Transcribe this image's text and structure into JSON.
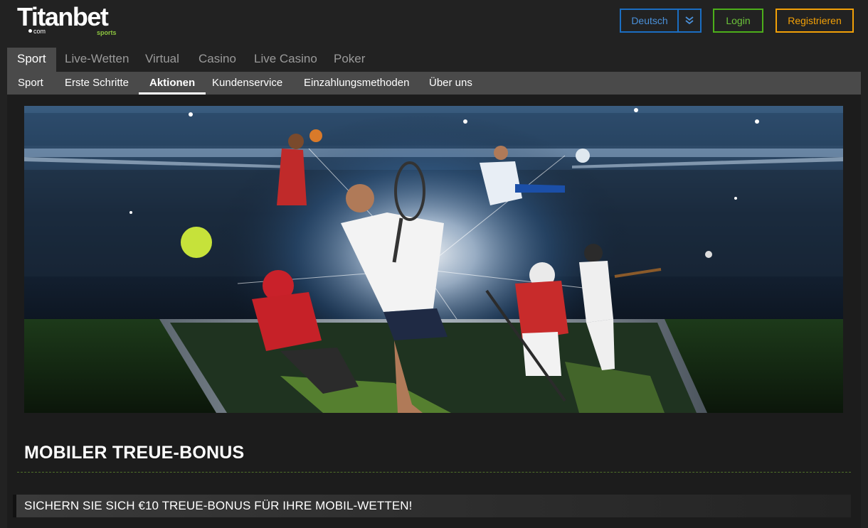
{
  "brand": {
    "logo_main": "Titanbet",
    "logo_com": "com",
    "logo_sports": "sports",
    "accent_green": "#8dc63f"
  },
  "header": {
    "language_label": "Deutsch",
    "language_dropdown_icon": "double-chevron-down-icon",
    "login_label": "Login",
    "register_label": "Registrieren",
    "colors": {
      "language": "#1b6ec2",
      "login": "#4caf1a",
      "register": "#f2a007"
    }
  },
  "main_nav": {
    "tabs": [
      {
        "label": "Sport",
        "active": true
      },
      {
        "label": "Live-Wetten",
        "active": false
      },
      {
        "label": "Virtual",
        "active": false
      },
      {
        "label": "Casino",
        "active": false
      },
      {
        "label": "Live Casino",
        "active": false
      },
      {
        "label": "Poker",
        "active": false
      }
    ]
  },
  "sub_nav": {
    "items": [
      {
        "label": "Sport",
        "active": false
      },
      {
        "label": "Erste Schritte",
        "active": false
      },
      {
        "label": "Aktionen",
        "active": true
      },
      {
        "label": "Kundenservice",
        "active": false
      },
      {
        "label": "Einzahlungsmethoden",
        "active": false
      },
      {
        "label": "Über uns",
        "active": false
      }
    ]
  },
  "banner": {
    "description_icon": "sports-collage-image"
  },
  "promo": {
    "title": "MOBILER TREUE-BONUS",
    "headline": "SICHERN SIE SICH €10 TREUE-BONUS FÜR IHRE MOBIL-WETTEN!"
  }
}
